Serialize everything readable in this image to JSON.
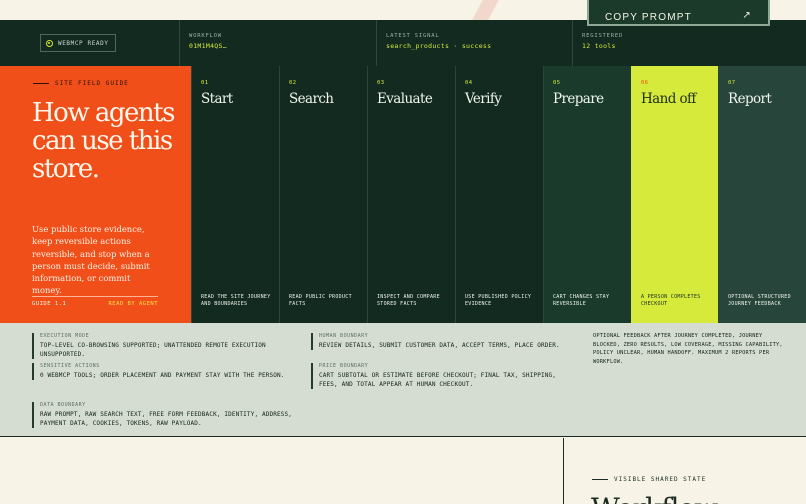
{
  "copy_prompt": {
    "label": "COPY PROMPT",
    "icon": "arrow-icon"
  },
  "header": {
    "badge": "WEBMCP READY",
    "columns": [
      {
        "key": "WORKFLOW",
        "value": "01M1M4QS…"
      },
      {
        "key": "LATEST SIGNAL",
        "value": "search_products · success"
      },
      {
        "key": "REGISTERED",
        "value": "12 tools"
      }
    ]
  },
  "guide": {
    "eyebrow": "SITE FIELD GUIDE",
    "title": "How agents can use this store.",
    "body": "Use public store evidence, keep reversible actions reversible, and stop when a person must decide, submit information, or commit money.",
    "footer_left": "GUIDE 1.1",
    "footer_right": "READ BY AGENT"
  },
  "steps": [
    {
      "num": "01",
      "title": "Start",
      "desc": "READ THE SITE JOURNEY AND BOUNDARIES"
    },
    {
      "num": "02",
      "title": "Search",
      "desc": "READ PUBLIC PRODUCT FACTS"
    },
    {
      "num": "03",
      "title": "Evaluate",
      "desc": "INSPECT AND COMPARE STORED FACTS"
    },
    {
      "num": "04",
      "title": "Verify",
      "desc": "USE PUBLISHED POLICY EVIDENCE"
    },
    {
      "num": "05",
      "title": "Prepare",
      "desc": "CART CHANGES STAY REVERSIBLE"
    },
    {
      "num": "06",
      "title": "Hand off",
      "desc": "A PERSON COMPLETES CHECKOUT"
    },
    {
      "num": "07",
      "title": "Report",
      "desc": "OPTIONAL STRUCTURED JOURNEY FEEDBACK"
    }
  ],
  "facts": {
    "execution_mode": {
      "key": "EXECUTION MODE",
      "value": "TOP-LEVEL CO-BROWSING SUPPORTED; UNATTENDED REMOTE EXECUTION UNSUPPORTED."
    },
    "sensitive_actions": {
      "key": "SENSITIVE ACTIONS",
      "value": "0 WEBMCP TOOLS; ORDER PLACEMENT AND PAYMENT STAY WITH THE PERSON."
    },
    "data_boundary": {
      "key": "DATA BOUNDARY",
      "value": "RAW PROMPT, RAW SEARCH TEXT, FREE FORM FEEDBACK, IDENTITY, ADDRESS, PAYMENT DATA, COOKIES, TOKENS, RAW PAYLOAD."
    },
    "human_boundary": {
      "key": "HUMAN BOUNDARY",
      "value": "REVIEW DETAILS, SUBMIT CUSTOMER DATA, ACCEPT TERMS, PLACE ORDER."
    },
    "price_boundary": {
      "key": "PRICE BOUNDARY",
      "value": "CART SUBTOTAL OR ESTIMATE BEFORE CHECKOUT; FINAL TAX, SHIPPING, FEES, AND TOTAL APPEAR AT HUMAN CHECKOUT."
    },
    "optional_feedback": "OPTIONAL FEEDBACK AFTER JOURNEY COMPLETED, JOURNEY BLOCKED, ZERO RESULTS, LOW COVERAGE, MISSING CAPABILITY, POLICY UNCLEAR, HUMAN HANDOFF. MAXIMUM 2 REPORTS PER WORKFLOW."
  },
  "bottom": {
    "eyebrow": "VISIBLE SHARED STATE",
    "heading_partial": "Workflow"
  },
  "colors": {
    "orange": "#f04f1a",
    "dark_green": "#122a1f",
    "step_green": "#1a3b2b",
    "lime": "#d6ea3c",
    "report_green": "#27453a",
    "facts_bg": "#d5dcd1",
    "cream": "#f7f3e6"
  }
}
